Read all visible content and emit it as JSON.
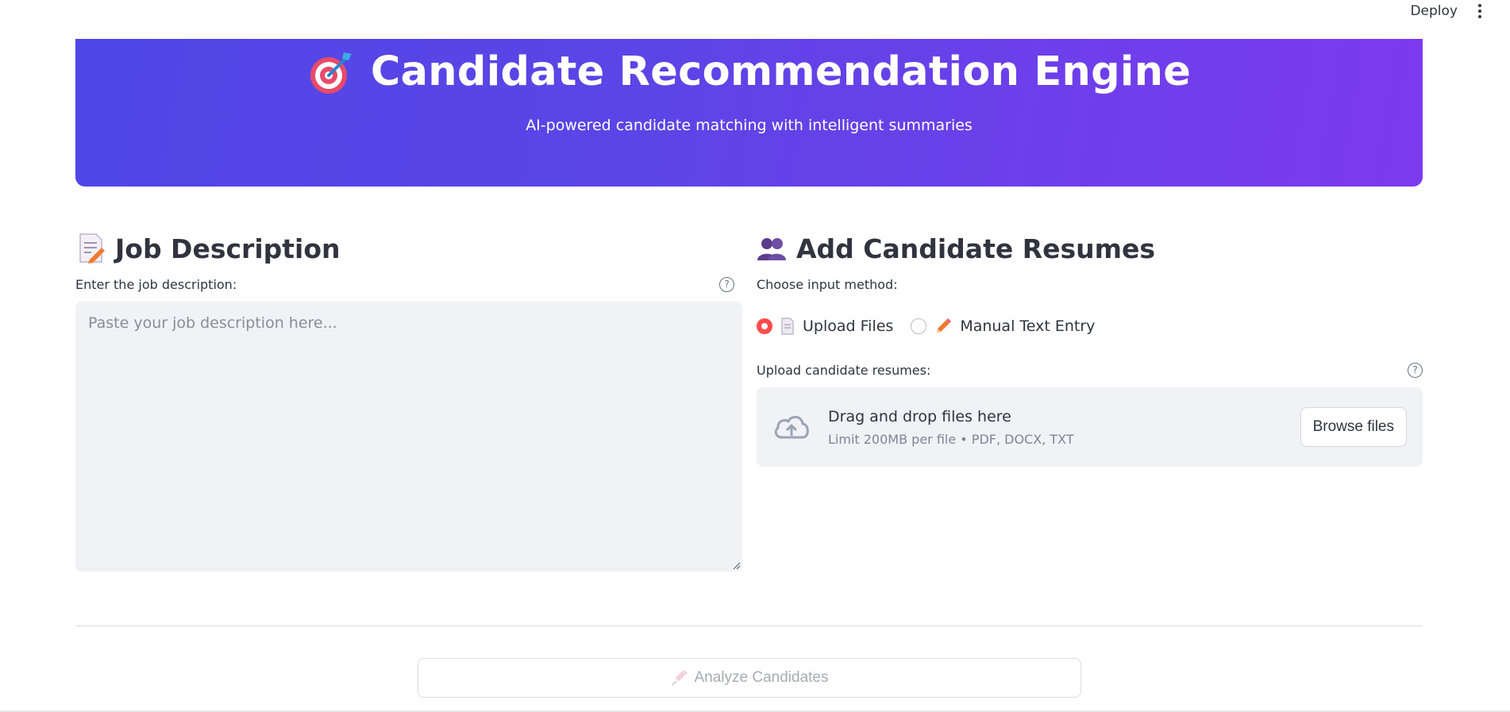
{
  "toolbar": {
    "deploy_label": "Deploy"
  },
  "hero": {
    "title": "Candidate Recommendation Engine",
    "subtitle": "AI-powered candidate matching with intelligent summaries",
    "icon": "target-icon"
  },
  "job_description": {
    "heading": "Job Description",
    "heading_icon": "memo-icon",
    "field_label": "Enter the job description:",
    "placeholder": "Paste your job description here..."
  },
  "resumes": {
    "heading": "Add Candidate Resumes",
    "heading_icon": "people-icon",
    "method_label": "Choose input method:",
    "options": [
      {
        "label": "Upload Files",
        "icon": "document-icon",
        "selected": true
      },
      {
        "label": "Manual Text Entry",
        "icon": "pencil-icon",
        "selected": false
      }
    ],
    "upload_label": "Upload candidate resumes:",
    "dropzone_title": "Drag and drop files here",
    "dropzone_hint": "Limit 200MB per file • PDF, DOCX, TXT",
    "browse_label": "Browse files"
  },
  "actions": {
    "analyze_label": "Analyze Candidates",
    "analyze_icon": "syringe-icon"
  },
  "colors": {
    "accent": "#ff4b4b",
    "hero_start": "#4f46e5",
    "hero_end": "#7c3aed"
  }
}
